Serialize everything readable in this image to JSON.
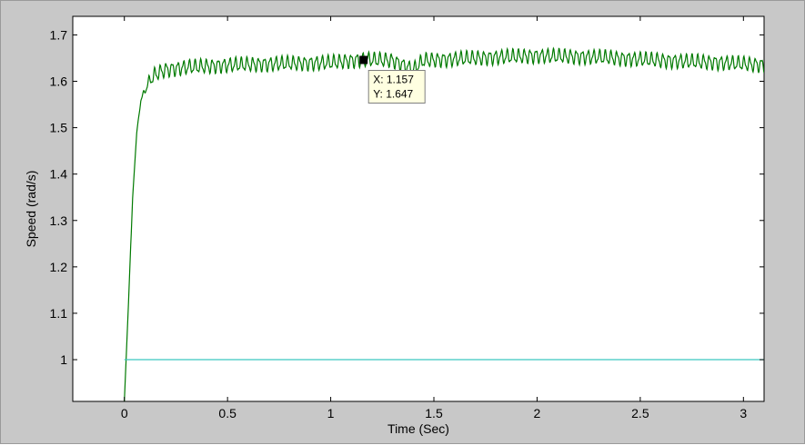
{
  "chart_data": {
    "type": "line",
    "xlabel": "Time (Sec)",
    "ylabel": "Speed (rad/s)",
    "xlim": [
      -0.25,
      3.1
    ],
    "ylim": [
      0.91,
      1.74
    ],
    "xticks": [
      0,
      0.5,
      1,
      1.5,
      2,
      2.5,
      3
    ],
    "xtick_labels": [
      "0",
      "0.5",
      "1",
      "1.5",
      "2",
      "2.5",
      "3"
    ],
    "yticks": [
      1,
      1.1,
      1.2,
      1.3,
      1.4,
      1.5,
      1.6,
      1.7
    ],
    "ytick_labels": [
      "1",
      "1.1",
      "1.2",
      "1.3",
      "1.4",
      "1.5",
      "1.6",
      "1.7"
    ],
    "grid": false,
    "series": [
      {
        "color": "#007a00",
        "style": "oscillating",
        "oscillation_amplitude": 0.013,
        "oscillation_period": 0.028,
        "x": [
          0.0,
          0.02,
          0.04,
          0.06,
          0.08,
          0.1,
          0.12,
          0.15,
          0.2,
          0.3,
          0.5,
          0.75,
          1.0,
          1.157,
          1.3,
          1.4,
          1.45,
          1.6,
          1.8,
          2.0,
          2.3,
          2.6,
          2.9,
          3.1
        ],
        "y": [
          0.91,
          1.12,
          1.35,
          1.49,
          1.56,
          1.58,
          1.6,
          1.615,
          1.625,
          1.63,
          1.635,
          1.638,
          1.64,
          1.647,
          1.645,
          1.625,
          1.645,
          1.648,
          1.652,
          1.655,
          1.652,
          1.645,
          1.64,
          1.635
        ]
      },
      {
        "color": "#3cc8c0",
        "style": "flat",
        "x": [
          0.0,
          3.1
        ],
        "y": [
          1.0,
          1.0
        ]
      }
    ],
    "annotations": [
      {
        "type": "datatip",
        "x": 1.157,
        "y": 1.647,
        "x_text": "X: 1.157",
        "y_text": "Y: 1.647"
      }
    ]
  }
}
